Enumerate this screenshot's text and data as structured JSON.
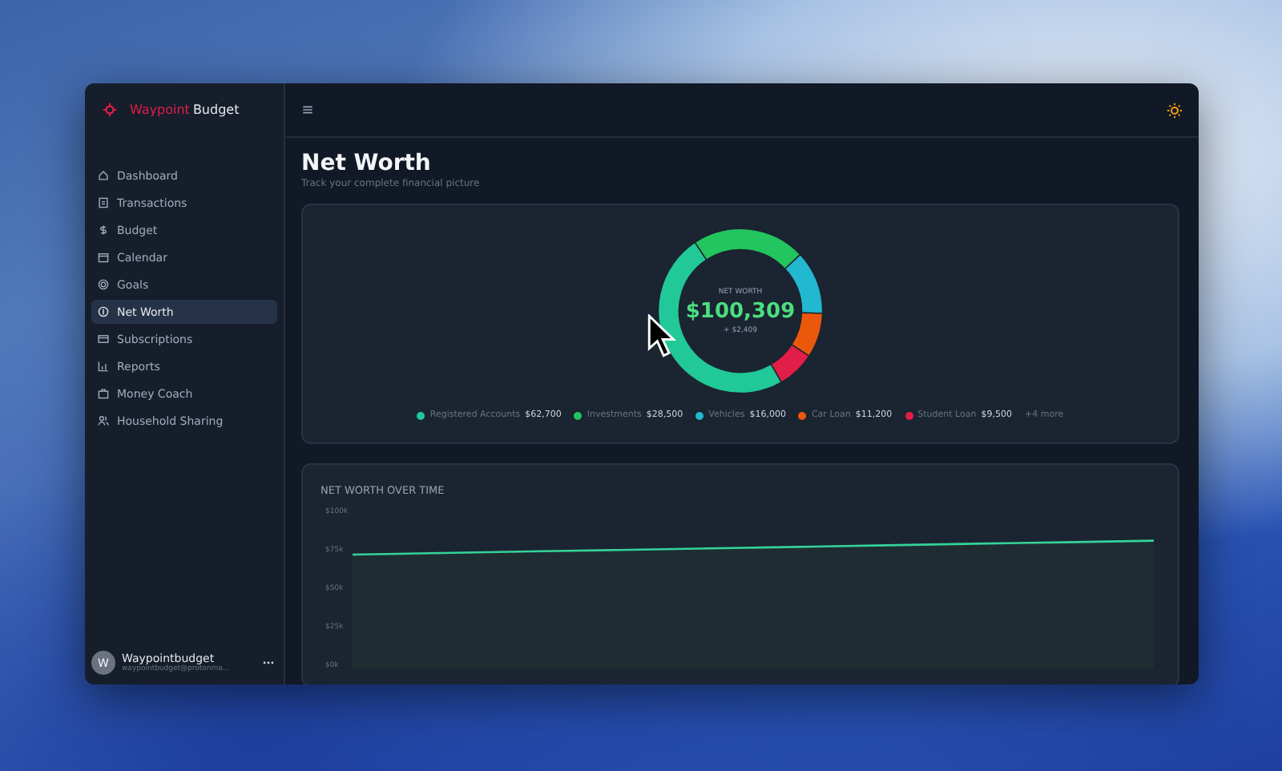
{
  "app": {
    "brand_first": "Waypoint",
    "brand_second": "Budget"
  },
  "sidebar": {
    "items": [
      {
        "label": "Dashboard",
        "selected": false
      },
      {
        "label": "Transactions",
        "selected": false
      },
      {
        "label": "Budget",
        "selected": false
      },
      {
        "label": "Calendar",
        "selected": false
      },
      {
        "label": "Goals",
        "selected": false
      },
      {
        "label": "Net Worth",
        "selected": true
      },
      {
        "label": "Subscriptions",
        "selected": false
      },
      {
        "label": "Reports",
        "selected": false
      },
      {
        "label": "Money Coach",
        "selected": false
      },
      {
        "label": "Household Sharing",
        "selected": false
      }
    ]
  },
  "user": {
    "initial": "W",
    "name": "Waypointbudget",
    "email": "waypointbudget@protonma..."
  },
  "page": {
    "title": "Net Worth",
    "subtitle": "Track your complete financial picture"
  },
  "breakdown": {
    "center_label": "NET WORTH",
    "center_value": "$100,309",
    "center_change": "+ $2,409",
    "legend": [
      {
        "label": "Registered Accounts",
        "amount": "$62,700",
        "color": "#20c997"
      },
      {
        "label": "Investments",
        "amount": "$28,500",
        "color": "#22c55e"
      },
      {
        "label": "Vehicles",
        "amount": "$16,000",
        "color": "#22b8cf"
      },
      {
        "label": "Car Loan",
        "amount": "$11,200",
        "color": "#ea580c"
      },
      {
        "label": "Student Loan",
        "amount": "$9,500",
        "color": "#e11d48"
      }
    ],
    "more": "+4 more"
  },
  "history": {
    "title": "NET WORTH OVER TIME",
    "chart_data": {
      "type": "area",
      "series": [
        {
          "color": "#34d399",
          "values": [
            74000,
            75000,
            76000,
            77000,
            78000,
            79000,
            80000,
            81000,
            82000,
            83000
          ]
        }
      ],
      "ylim": [
        0,
        100000
      ],
      "yticks": [
        {
          "value": 100000,
          "label": "$100k"
        },
        {
          "value": 75000,
          "label": "$75k"
        },
        {
          "value": 50000,
          "label": "$50k"
        },
        {
          "value": 25000,
          "label": "$25k"
        },
        {
          "value": 0,
          "label": "$0k"
        }
      ]
    }
  }
}
